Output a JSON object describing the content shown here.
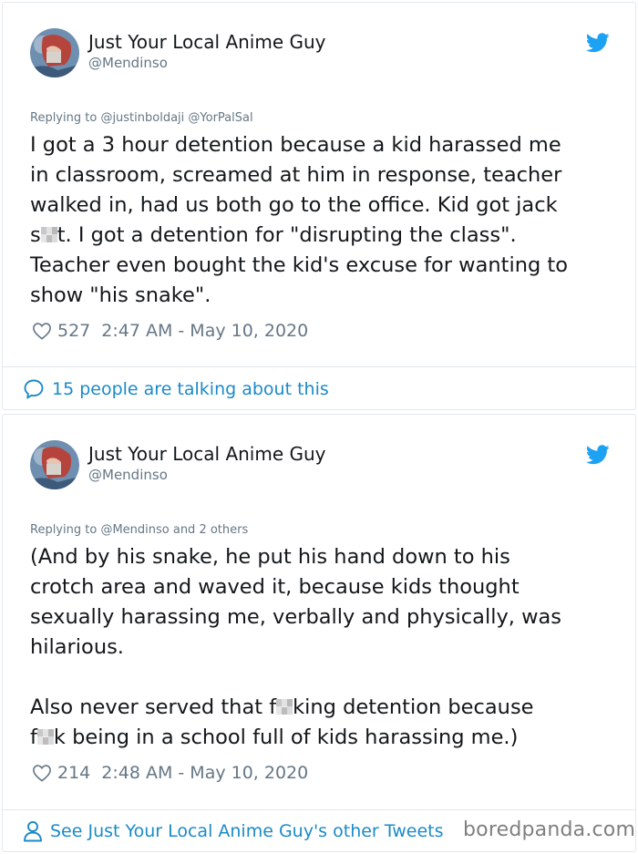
{
  "tweets": [
    {
      "author_name": "Just Your Local Anime Guy",
      "author_handle": "@Mendinso",
      "replying_prefix": "Replying to",
      "replying_to": "@justinboldaji @YorPalSal",
      "lines": {
        "l1": "I got a 3 hour detention because a kid harassed me",
        "l2": "in classroom, screamed at him in response, teacher",
        "l3": "walked in, had us both go to the office. Kid got jack",
        "l4a": "s",
        "l4b": "t. I got a detention for \"disrupting the class\".",
        "l5": "Teacher even bought the kid's excuse for wanting to",
        "l6": "show \"his snake\"."
      },
      "likes": "527",
      "timestamp": "2:47 AM - May 10, 2020",
      "footer": "15 people are talking about this"
    },
    {
      "author_name": "Just Your Local Anime Guy",
      "author_handle": "@Mendinso",
      "replying_prefix": "Replying to",
      "replying_to": "@Mendinso and 2 others",
      "lines": {
        "l1": "(And by his snake, he put his hand down to his",
        "l2": "crotch area and waved it, because kids thought",
        "l3": "sexually harassing me, verbally and physically, was",
        "l4": "hilarious.",
        "l5a": "Also never served that f",
        "l5b": "king detention because",
        "l6a": "f",
        "l6b": "k being in a school full of kids harassing me.)"
      },
      "likes": "214",
      "timestamp": "2:48 AM - May 10, 2020",
      "footer": "See Just Your Local Anime Guy's other Tweets"
    }
  ],
  "watermark": "boredpanda.com",
  "icons": {
    "bird": "twitter-bird-icon",
    "heart": "heart-icon",
    "bubble": "speech-bubble-icon",
    "person": "person-icon"
  },
  "colors": {
    "twitter_blue": "#1da1f2",
    "link_blue": "#1b8ac7",
    "text": "#14171a",
    "muted": "#657786",
    "border": "#e1e8ed"
  }
}
